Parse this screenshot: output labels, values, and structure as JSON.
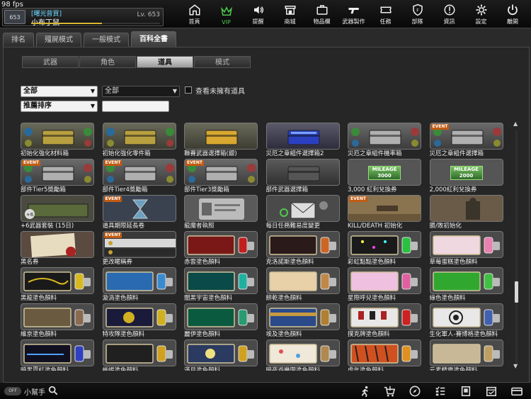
{
  "fps": "98 fps",
  "player": {
    "title": "[曙光曾買]",
    "name": "小布丁鼠",
    "level": "Lv. 653",
    "rank_value": "653",
    "exp_progress": 0.55
  },
  "nav": [
    {
      "label": "首頁",
      "icon": "home-icon"
    },
    {
      "label": "VIP",
      "icon": "crown-icon"
    },
    {
      "label": "提醒",
      "icon": "speaker-icon"
    },
    {
      "label": "商城",
      "icon": "shop-icon"
    },
    {
      "label": "物品欄",
      "icon": "bag-icon"
    },
    {
      "label": "武器製作",
      "icon": "gun-icon"
    },
    {
      "label": "任務",
      "icon": "ticket-icon"
    },
    {
      "label": "部隊",
      "icon": "shield-icon"
    },
    {
      "label": "資訊",
      "icon": "info-icon"
    },
    {
      "label": "設定",
      "icon": "gear-icon"
    },
    {
      "label": "離開",
      "icon": "power-icon"
    }
  ],
  "main_tabs": [
    "排名",
    "殭屍模式",
    "一般模式",
    "百科全書"
  ],
  "sub_tabs": [
    "武器",
    "角色",
    "道具",
    "模式"
  ],
  "filters": {
    "category": "全部",
    "subcategory": "全部",
    "sort": "推薦排序",
    "show_unowned_label": "查看未擁有道具",
    "search_value": ""
  },
  "items": [
    {
      "name": "初始化強化材料箱",
      "theme": "box-gold",
      "event": ""
    },
    {
      "name": "初始化強化零件箱",
      "theme": "box-gold",
      "event": ""
    },
    {
      "name": "聯賽武器選擇箱(銀)",
      "theme": "box-gold-only",
      "event": ""
    },
    {
      "name": "災厄之章組件選擇箱2",
      "theme": "box-blue",
      "event": ""
    },
    {
      "name": "災厄之章組件機率箱",
      "theme": "box-silver",
      "event": ""
    },
    {
      "name": "災厄之章組件選擇箱",
      "theme": "box-silver",
      "event": "EVENT"
    },
    {
      "name": "部件Tier5獎勵箱",
      "theme": "box-silver",
      "event": "EVENT"
    },
    {
      "name": "部件Tier4獎勵箱",
      "theme": "box-silver",
      "event": "EVENT"
    },
    {
      "name": "部件Tier3獎勵箱",
      "theme": "box-silver",
      "event": "EVENT"
    },
    {
      "name": "部件武器選擇箱",
      "theme": "box-dark",
      "event": ""
    },
    {
      "name": "3,000 紅利兌換券",
      "theme": "mileage",
      "event": "",
      "mileage": "MILEAGE",
      "amount": "3000"
    },
    {
      "name": "2,000紅利兌換券",
      "theme": "mileage",
      "event": "",
      "mileage": "MILEAGE",
      "amount": "2000"
    },
    {
      "name": "+6武器套裝 (15日)",
      "theme": "crate",
      "event": ""
    },
    {
      "name": "道具期限延長卷",
      "theme": "hourglass",
      "event": "EVENT"
    },
    {
      "name": "龍魔者執照",
      "theme": "license",
      "event": ""
    },
    {
      "name": "每日任務難易度變更",
      "theme": "mail",
      "event": ""
    },
    {
      "name": "KILL/DEATH 初始化",
      "theme": "photo-desert",
      "event": "EVENT"
    },
    {
      "name": "勝/敗初始化",
      "theme": "photo-soldier",
      "event": ""
    },
    {
      "name": "黑名券",
      "theme": "scroll",
      "event": ""
    },
    {
      "name": "更改暱稱券",
      "theme": "nickname",
      "event": "EVENT"
    },
    {
      "name": "赤雲塗色顏料",
      "theme": "paint-red",
      "event": ""
    },
    {
      "name": "克洛諾斯塗色顏料",
      "theme": "paint-dark",
      "event": ""
    },
    {
      "name": "彩虹點點塗色顏料",
      "theme": "paint-dots",
      "event": ""
    },
    {
      "name": "草莓蛋糕塗色顏料",
      "theme": "paint-pink",
      "event": ""
    },
    {
      "name": "黑龍塗色顏料",
      "theme": "paint-gold",
      "event": ""
    },
    {
      "name": "漩渦塗色顏料",
      "theme": "paint-wave",
      "event": ""
    },
    {
      "name": "闇黑宇宙塗色顏料",
      "theme": "paint-teal",
      "event": ""
    },
    {
      "name": "餅乾塗色顏料",
      "theme": "paint-cookie",
      "event": ""
    },
    {
      "name": "星際呼兒塗色顏料",
      "theme": "paint-anime",
      "event": ""
    },
    {
      "name": "綠色塗色顏料",
      "theme": "paint-green",
      "event": ""
    },
    {
      "name": "維京塗色顏料",
      "theme": "paint-viking",
      "event": ""
    },
    {
      "name": "特攻隊塗色顏料",
      "theme": "paint-spec",
      "event": ""
    },
    {
      "name": "麗伊塗色顏料",
      "theme": "paint-jade",
      "event": ""
    },
    {
      "name": "埃及塗色顏料",
      "theme": "paint-egypt",
      "event": ""
    },
    {
      "name": "撲克牌塗色顏料",
      "theme": "paint-cards",
      "event": ""
    },
    {
      "name": "生化軍人-賽博格塗色顏料",
      "theme": "paint-target",
      "event": ""
    },
    {
      "name": "暗黑霓虹塗色顏料",
      "theme": "paint-neon",
      "event": ""
    },
    {
      "name": "蜥蜴塗色顏料",
      "theme": "paint-lizard",
      "event": ""
    },
    {
      "name": "滿月塗色顏料",
      "theme": "paint-moon",
      "event": ""
    },
    {
      "name": "暗夜遊樂園塗色顏料",
      "theme": "paint-park",
      "event": ""
    },
    {
      "name": "虎年塗色顏料",
      "theme": "paint-tiger",
      "event": ""
    },
    {
      "name": "元素精靈塗色顏料",
      "theme": "paint-element",
      "event": ""
    }
  ],
  "bottom": {
    "helper_toggle": "OFF",
    "helper_label": "小幫手"
  },
  "bottom_icons": [
    "runner-icon",
    "cart-icon",
    "compass-icon",
    "checklist-icon",
    "bookmark-icon",
    "calendar-icon",
    "card-icon"
  ]
}
